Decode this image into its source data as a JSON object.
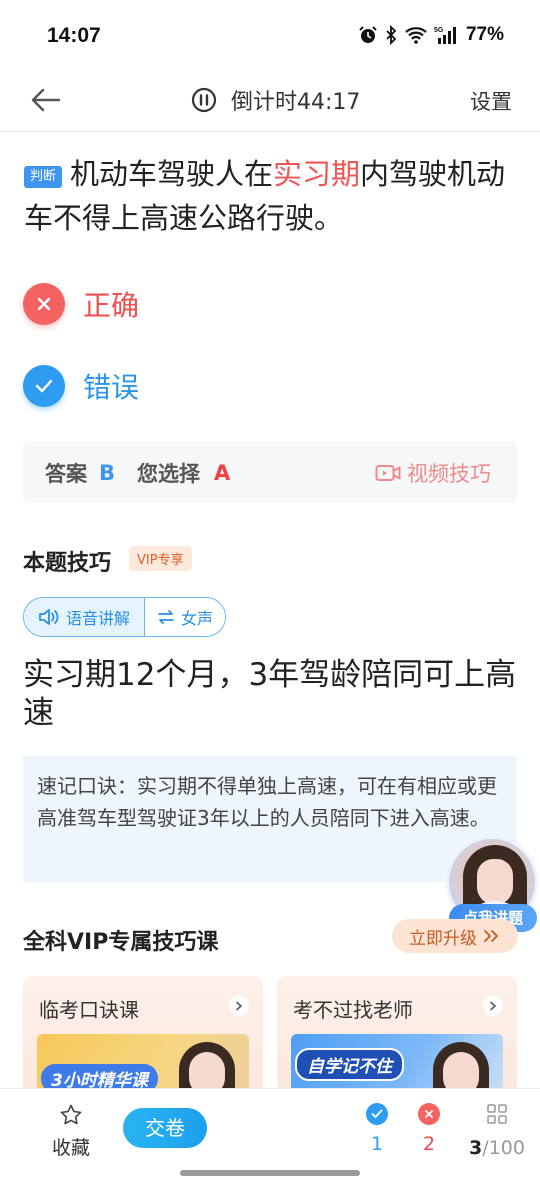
{
  "status_bar": {
    "time": "14:07",
    "battery": "77%"
  },
  "header": {
    "timer_text": "倒计时44:17",
    "settings_label": "设置"
  },
  "question": {
    "tag": "判断",
    "text_before": "机动车驾驶人在",
    "text_highlight": "实习期",
    "text_after": "内驾驶机动车不得上高速公路行驶。"
  },
  "options": [
    {
      "label": "正确",
      "state": "wrong-choice"
    },
    {
      "label": "错误",
      "state": "correct-answer"
    }
  ],
  "answer": {
    "answer_label": "答案",
    "correct_answer": "B",
    "chosen_label": "您选择",
    "chosen_answer": "A",
    "video_tip_label": "视频技巧"
  },
  "tips": {
    "title": "本题技巧",
    "vip_badge": "VIP专享",
    "voice_label": "语音讲解",
    "voice_switch_label": "女声",
    "heading": "实习期12个月，3年驾龄陪同可上高速",
    "mnemonic": "速记口诀：实习期不得单独上高速，可在有相应或更高准驾车型驾驶证3年以上的人员陪同下进入高速。"
  },
  "teacher": {
    "button_label": "点我讲题"
  },
  "vip_courses": {
    "title": "全科VIP专属技巧课",
    "upgrade_label": "立即升级",
    "cards": [
      {
        "title": "临考口诀课",
        "image_text": "3小时精华课"
      },
      {
        "title": "考不过找老师",
        "image_text": "自学记不住"
      }
    ]
  },
  "bottom_bar": {
    "favorite_label": "收藏",
    "submit_label": "交卷",
    "correct_count": "1",
    "wrong_count": "2",
    "current_question": "3",
    "total_questions": "/100"
  },
  "colors": {
    "accent_blue": "#2e9cf0",
    "error_red": "#f46262",
    "highlight_red": "#f05555"
  }
}
